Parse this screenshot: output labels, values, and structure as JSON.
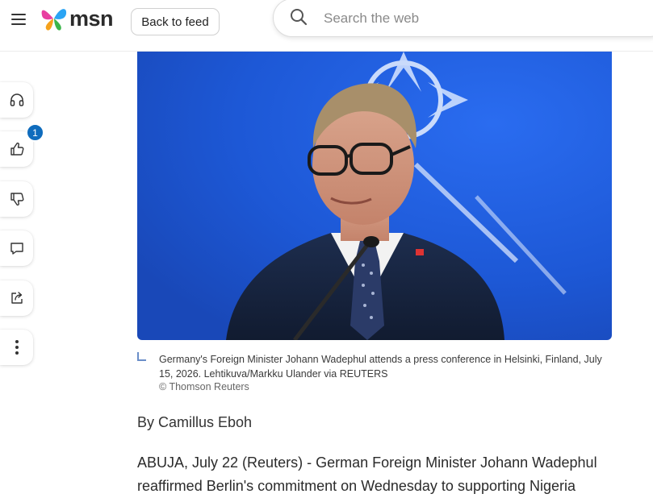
{
  "header": {
    "menu_icon": "hamburger-icon",
    "logo_text": "msn",
    "back_label": "Back to feed",
    "search_placeholder": "Search the web"
  },
  "rail": {
    "items": [
      {
        "icon": "headphones-icon",
        "label": "Listen"
      },
      {
        "icon": "thumbs-up-icon",
        "label": "Like",
        "badge": "1"
      },
      {
        "icon": "thumbs-down-icon",
        "label": "Dislike"
      },
      {
        "icon": "comment-icon",
        "label": "Comment"
      },
      {
        "icon": "share-icon",
        "label": "Share"
      },
      {
        "icon": "more-vertical-icon",
        "label": "More"
      }
    ]
  },
  "article": {
    "image_alt": "Germany's Foreign Minister Johann Wadephul speaking at a podium in front of a NATO flag",
    "caption": "Germany's Foreign Minister Johann Wadephul attends a press conference in Helsinki, Finland, July 15, 2026. Lehtikuva/Markku Ulander via REUTERS",
    "credit": "© Thomson Reuters",
    "byline": "By Camillus Eboh",
    "paragraph": "ABUJA, July 22 (Reuters) - German Foreign Minister Johann Wadephul reaffirmed Berlin's commitment on Wednesday to supporting Nigeria"
  },
  "colors": {
    "badge": "#0f6cbd",
    "flag_blue": "#1e5bd8",
    "text": "#1f1f1f"
  }
}
